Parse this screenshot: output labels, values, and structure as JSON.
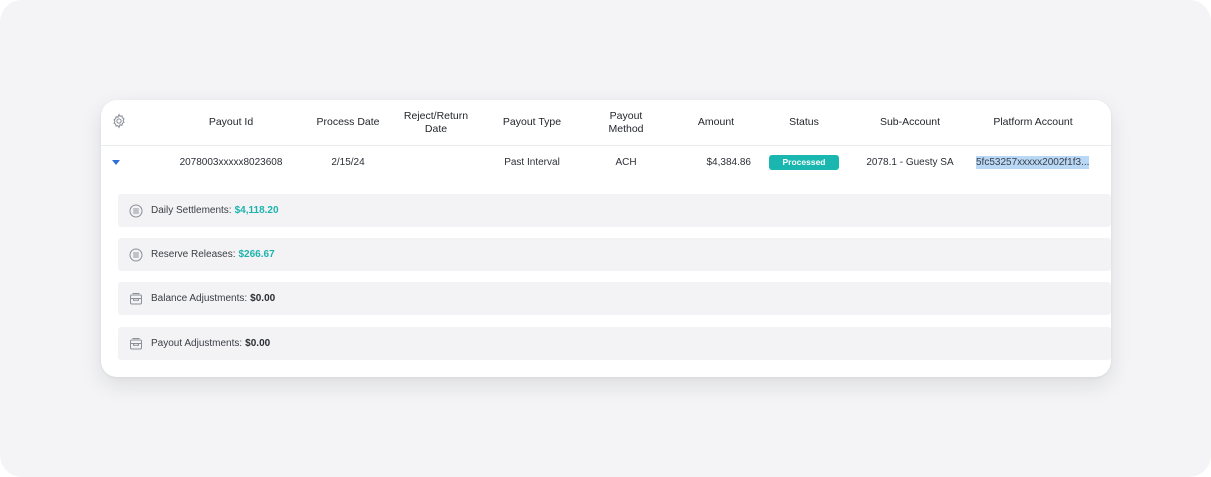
{
  "columns": [
    "Payout Id",
    "Process Date",
    "Reject/Return Date",
    "Payout Type",
    "Payout Method",
    "Amount",
    "Status",
    "Sub-Account",
    "Platform Account"
  ],
  "columns_display": {
    "payout_id": "Payout Id",
    "process_date": "Process Date",
    "reject_return_date_line1": "Reject/Return",
    "reject_return_date_line2": "Date",
    "payout_type": "Payout Type",
    "payout_method_line1": "Payout",
    "payout_method_line2": "Method",
    "amount": "Amount",
    "status": "Status",
    "sub_account": "Sub-Account",
    "platform_account": "Platform Account"
  },
  "row": {
    "payout_id": "2078003xxxxx8023608",
    "process_date": "2/15/24",
    "reject_return_date": "",
    "payout_type": "Past Interval",
    "payout_method": "ACH",
    "amount": "$4,384.86",
    "status": "Processed",
    "sub_account": "2078.1 - Guesty SA",
    "platform_account": "5fc53257xxxxx2002f1f3..."
  },
  "summaries": [
    {
      "label": "Daily Settlements:",
      "value": "$4,118.20",
      "icon": "list-icon"
    },
    {
      "label": "Reserve Releases:",
      "value": "$266.67",
      "icon": "list-icon"
    },
    {
      "label": "Balance Adjustments:",
      "value": "$0.00",
      "icon": "tray-icon"
    },
    {
      "label": "Payout Adjustments:",
      "value": "$0.00",
      "icon": "tray-icon"
    }
  ],
  "colors": {
    "status_badge": "#19b7b0",
    "accent_value": "#1db3ad",
    "caret": "#2f6fd6",
    "selection_highlight": "#b9d8f5"
  }
}
